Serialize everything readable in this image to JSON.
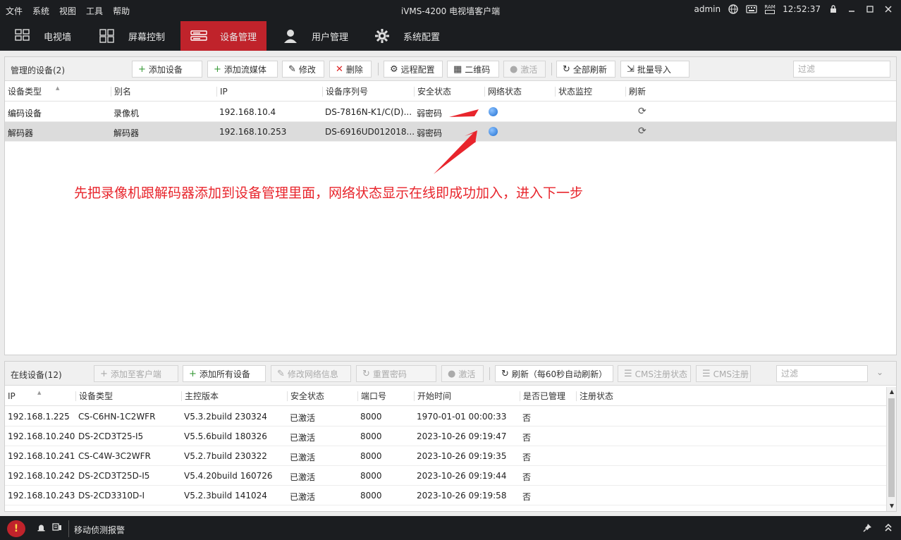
{
  "titlebar": {
    "menu": [
      "文件",
      "系统",
      "视图",
      "工具",
      "帮助"
    ],
    "title": "iVMS-4200 电视墙客户端",
    "user": "admin",
    "time": "12:52:37",
    "icons": [
      "globe-icon",
      "keyboard-icon",
      "ram-icon",
      "lock-icon",
      "minimize-icon",
      "maximize-icon",
      "close-icon"
    ],
    "ram_label": "RAM"
  },
  "nav": {
    "tabs": [
      {
        "label": "电视墙",
        "icon": "video-wall-icon"
      },
      {
        "label": "屏幕控制",
        "icon": "screen-grid-icon"
      },
      {
        "label": "设备管理",
        "icon": "device-icon",
        "active": true
      },
      {
        "label": "用户管理",
        "icon": "user-icon"
      },
      {
        "label": "系统配置",
        "icon": "gear-icon"
      }
    ]
  },
  "devices": {
    "title": "管理的设备(2)",
    "buttons": {
      "add_device": "添加设备",
      "add_stream": "添加流媒体",
      "modify": "修改",
      "delete": "删除",
      "remote_config": "远程配置",
      "qr_code": "二维码",
      "activate": "激活",
      "refresh_all": "全部刷新",
      "batch_import": "批量导入"
    },
    "filter_placeholder": "过滤",
    "columns": [
      "设备类型",
      "别名",
      "IP",
      "设备序列号",
      "安全状态",
      "网络状态",
      "状态监控",
      "刷新"
    ],
    "rows": [
      {
        "type": "编码设备",
        "alias": "录像机",
        "ip": "192.168.10.4",
        "serial": "DS-7816N-K1/C(D)...",
        "security": "弱密码",
        "network": "online"
      },
      {
        "type": "解码器",
        "alias": "解码器",
        "ip": "192.168.10.253",
        "serial": "DS-6916UD012018...",
        "security": "弱密码",
        "network": "online"
      }
    ],
    "annotation": "先把录像机跟解码器添加到设备管理里面，网络状态显示在线即成功加入，进入下一步",
    "annotation_color": "#e8252c"
  },
  "online": {
    "title": "在线设备(12)",
    "buttons": {
      "add_to_client": "添加至客户端",
      "add_all": "添加所有设备",
      "modify_net": "修改网络信息",
      "reset_pwd": "重置密码",
      "activate": "激活",
      "refresh": "刷新（每60秒自动刷新）",
      "cms_status": "CMS注册状态",
      "cms_register": "CMS注册"
    },
    "filter_placeholder": "过滤",
    "columns": [
      "IP",
      "设备类型",
      "主控版本",
      "安全状态",
      "端口号",
      "开始时间",
      "是否已管理",
      "注册状态"
    ],
    "rows": [
      {
        "ip": "192.168.1.225",
        "type": "CS-C6HN-1C2WFR",
        "fw": "V5.3.2build 230324",
        "security": "已激活",
        "port": "8000",
        "start": "1970-01-01 00:00:33",
        "managed": "否"
      },
      {
        "ip": "192.168.10.240",
        "type": "DS-2CD3T25-I5",
        "fw": "V5.5.6build 180326",
        "security": "已激活",
        "port": "8000",
        "start": "2023-10-26 09:19:47",
        "managed": "否"
      },
      {
        "ip": "192.168.10.241",
        "type": "CS-C4W-3C2WFR",
        "fw": "V5.2.7build 230322",
        "security": "已激活",
        "port": "8000",
        "start": "2023-10-26 09:19:35",
        "managed": "否"
      },
      {
        "ip": "192.168.10.242",
        "type": "DS-2CD3T25D-I5",
        "fw": "V5.4.20build 160726",
        "security": "已激活",
        "port": "8000",
        "start": "2023-10-26 09:19:44",
        "managed": "否"
      },
      {
        "ip": "192.168.10.243",
        "type": "DS-2CD3310D-I",
        "fw": "V5.2.3build 141024",
        "security": "已激活",
        "port": "8000",
        "start": "2023-10-26 09:19:58",
        "managed": "否"
      }
    ]
  },
  "statusbar": {
    "alarm_text": "移动侦测报警",
    "icons": [
      "warning-icon",
      "bell-icon",
      "display-icon",
      "pin-icon",
      "expand-icon"
    ]
  }
}
